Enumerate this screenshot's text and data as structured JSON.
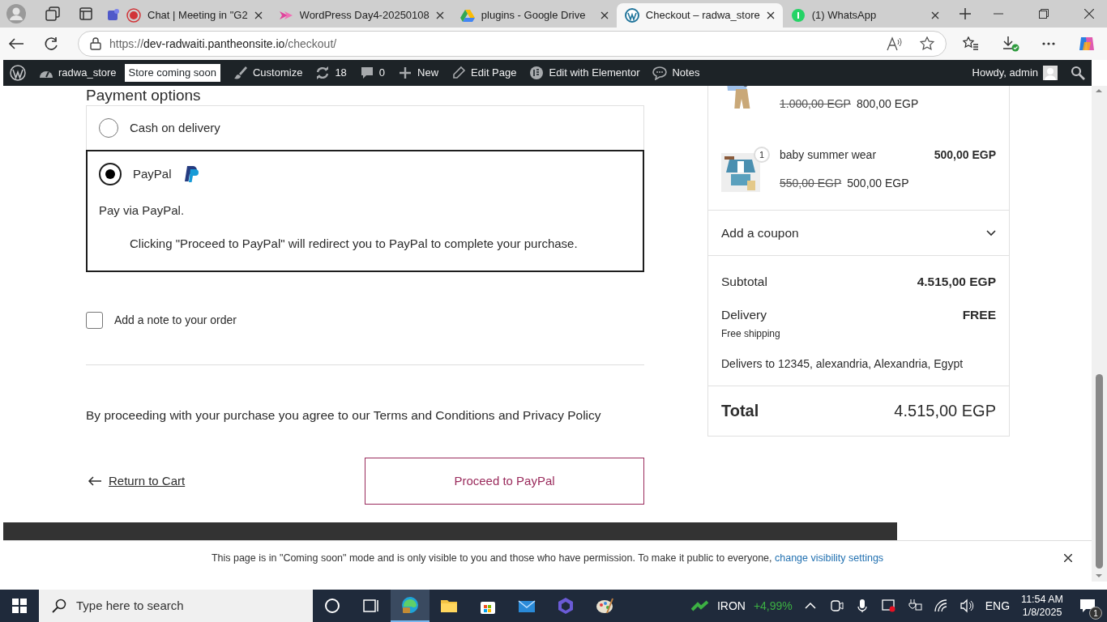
{
  "browser": {
    "tabs": [
      {
        "title": "Chat | Meeting in \"G2",
        "selected": false
      },
      {
        "title": "WordPress Day4-20250108",
        "selected": false
      },
      {
        "title": "plugins - Google Drive",
        "selected": false
      },
      {
        "title": "Checkout – radwa_store",
        "selected": true
      },
      {
        "title": "(1) WhatsApp",
        "selected": false
      }
    ],
    "url_scheme": "https://",
    "url_host": "dev-radwaiti.pantheonsite.io",
    "url_path": "/checkout/"
  },
  "admin_bar": {
    "site": "radwa_store",
    "badge": "Store coming soon",
    "items": [
      {
        "label": "Customize"
      },
      {
        "label": "18"
      },
      {
        "label": "0"
      },
      {
        "label": "New"
      },
      {
        "label": "Edit Page"
      },
      {
        "label": "Edit with Elementor"
      },
      {
        "label": "Notes"
      }
    ],
    "greeting": "Howdy, admin"
  },
  "payment": {
    "heading": "Payment options",
    "options": [
      {
        "label": "Cash on delivery",
        "selected": false
      },
      {
        "label": "PayPal",
        "selected": true,
        "description": "Pay via PayPal.",
        "note": "Clicking \"Proceed to PayPal\" will redirect you to PayPal to complete your purchase."
      }
    ],
    "order_note": {
      "label": "Add a note to your order",
      "checked": false
    },
    "terms": "By proceeding with your purchase you agree to our Terms and Conditions and Privacy Policy",
    "return_link": "Return to Cart",
    "proceed_button": "Proceed to PayPal"
  },
  "summary": {
    "items": [
      {
        "old_price": "1.000,00 EGP",
        "new_price": "800,00 EGP"
      },
      {
        "quantity": "1",
        "name": "baby summer wear",
        "price": "500,00 EGP",
        "old_price": "550,00 EGP",
        "new_price": "500,00 EGP"
      }
    ],
    "coupon": "Add a coupon",
    "subtotal_label": "Subtotal",
    "subtotal": "4.515,00 EGP",
    "delivery_label": "Delivery",
    "delivery": "FREE",
    "delivery_method": "Free shipping",
    "delivers_to": "Delivers to 12345, alexandria, Alexandria, Egypt",
    "total_label": "Total",
    "total": "4.515,00 EGP"
  },
  "notice": {
    "text": "This page is in \"Coming soon\" mode and is only visible to you and those who have permission. To make it public to everyone,",
    "link": "change visibility settings"
  },
  "taskbar": {
    "search_placeholder": "Type here to search",
    "ticker": "IRON",
    "ticker_change": "+4,99%",
    "language": "ENG",
    "time": "11:54 AM",
    "date": "1/8/2025",
    "notifications": "1"
  }
}
